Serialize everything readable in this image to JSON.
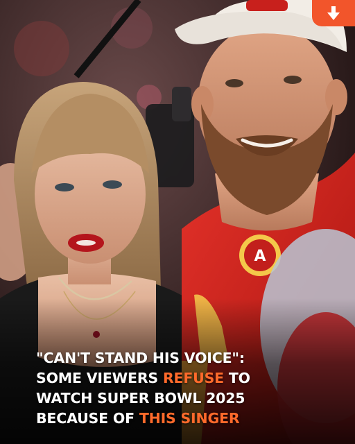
{
  "headline": {
    "line1": "\"CAN'T STAND HIS VOICE\":",
    "line2_a": "SOME VIEWERS ",
    "line2_highlight": "REFUSE",
    "line2_b": " TO",
    "line3": "WATCH SUPER BOWL 2025",
    "line4_a": "BECAUSE OF ",
    "line4_highlight": "THIS SINGER"
  },
  "badge": {
    "icon": "download-arrow-icon",
    "color": "#f2552b"
  },
  "colors": {
    "accent": "#ff6a2b",
    "text": "#ffffff",
    "jersey": "#d8261e"
  }
}
